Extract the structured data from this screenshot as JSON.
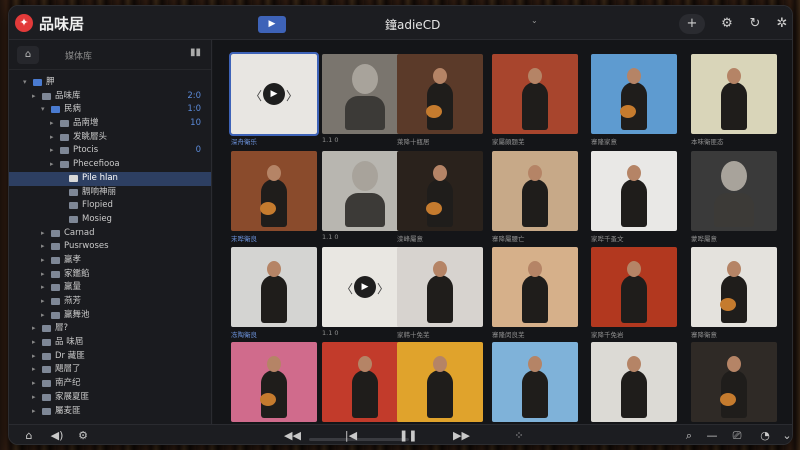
{
  "app": {
    "title": "品味居",
    "window_title": "鐘adieCD",
    "title_small": "⌄",
    "logo_glyph": "✦"
  },
  "titlebar": {
    "play_glyph": "▶",
    "icons": [
      "add-icon",
      "gear-icon",
      "refresh-icon",
      "settings-cog-icon"
    ],
    "glyphs": [
      "+",
      "⚙",
      "↻",
      "✲"
    ]
  },
  "sidebar": {
    "header_label": "媒体库",
    "button_glyph": "⌂",
    "chart_glyph": "▮▮",
    "tree": [
      {
        "label": "胛",
        "indent": 0,
        "arrow": "▾",
        "folder": "blue",
        "count": ""
      },
      {
        "label": "品味库",
        "indent": 1,
        "arrow": "▸",
        "folder": "grey",
        "count": "2:0"
      },
      {
        "label": "民病",
        "indent": 2,
        "arrow": "▾",
        "folder": "blue",
        "count": "1:0"
      },
      {
        "label": "品南增",
        "indent": 3,
        "arrow": "▸",
        "folder": "grey",
        "count": "10"
      },
      {
        "label": "发眺層头",
        "indent": 3,
        "arrow": "▸",
        "folder": "grey",
        "count": ""
      },
      {
        "label": "Ptocis",
        "indent": 3,
        "arrow": "▸",
        "folder": "grey",
        "count": "0"
      },
      {
        "label": "Phecefiooa",
        "indent": 3,
        "arrow": "▸",
        "folder": "grey",
        "count": ""
      },
      {
        "label": "Pile hlan",
        "indent": 4,
        "arrow": "",
        "folder": "white",
        "count": ""
      },
      {
        "label": "膈响神丽",
        "indent": 4,
        "arrow": "",
        "folder": "grey",
        "count": ""
      },
      {
        "label": "Flopied",
        "indent": 4,
        "arrow": "",
        "folder": "grey",
        "count": ""
      },
      {
        "label": "Mosieg",
        "indent": 4,
        "arrow": "",
        "folder": "grey",
        "count": ""
      },
      {
        "label": "Carnad",
        "indent": 2,
        "arrow": "▸",
        "folder": "grey",
        "count": ""
      },
      {
        "label": "Pusrwoses",
        "indent": 2,
        "arrow": "▸",
        "folder": "grey",
        "count": ""
      },
      {
        "label": "羸孝",
        "indent": 2,
        "arrow": "▸",
        "folder": "grey",
        "count": ""
      },
      {
        "label": "家鑑餡",
        "indent": 2,
        "arrow": "▸",
        "folder": "grey",
        "count": ""
      },
      {
        "label": "羸量",
        "indent": 2,
        "arrow": "▸",
        "folder": "grey",
        "count": ""
      },
      {
        "label": "燕芳",
        "indent": 2,
        "arrow": "▸",
        "folder": "grey",
        "count": ""
      },
      {
        "label": "羸舞池",
        "indent": 2,
        "arrow": "▸",
        "folder": "grey",
        "count": ""
      },
      {
        "label": "層?",
        "indent": 1,
        "arrow": "▸",
        "folder": "grey",
        "count": ""
      },
      {
        "label": "品 味屆",
        "indent": 1,
        "arrow": "▸",
        "folder": "grey",
        "count": ""
      },
      {
        "label": "Dr 藏匪",
        "indent": 1,
        "arrow": "▸",
        "folder": "grey",
        "count": ""
      },
      {
        "label": "飓層了",
        "indent": 1,
        "arrow": "▸",
        "folder": "grey",
        "count": ""
      },
      {
        "label": "南产纪",
        "indent": 1,
        "arrow": "▸",
        "folder": "grey",
        "count": ""
      },
      {
        "label": "家展夏匪",
        "indent": 1,
        "arrow": "▸",
        "folder": "grey",
        "count": ""
      },
      {
        "label": "屬麦匪",
        "indent": 1,
        "arrow": "▸",
        "folder": "grey",
        "count": ""
      }
    ],
    "selected_index": 7
  },
  "grid": {
    "tiles": [
      {
        "caption": "深舟衛乐",
        "bg": "#e8e6e2",
        "kind": "play",
        "active": true
      },
      {
        "caption": "1.1 0",
        "bg": "#7a756e",
        "kind": "face",
        "active": false
      },
      {
        "caption": "萊降十瓶居",
        "bg": "#5b3a29",
        "kind": "guitar",
        "active": false
      },
      {
        "caption": "家屬頗题芜",
        "bg": "#a8452d",
        "kind": "figure",
        "active": false
      },
      {
        "caption": "寨隆家意",
        "bg": "#5e9bd0",
        "kind": "guitar",
        "active": false
      },
      {
        "caption": "本味衛匪态",
        "bg": "#d9d5b9",
        "kind": "figure",
        "active": false
      },
      {
        "caption": "末哗衛良",
        "bg": "#8a4b2c",
        "kind": "guitar",
        "active": true
      },
      {
        "caption": "1.1 0",
        "bg": "#b8b6b0",
        "kind": "face",
        "active": false
      },
      {
        "caption": "滦峰屬意",
        "bg": "#2a221c",
        "kind": "guitar",
        "active": false
      },
      {
        "caption": "寨降屬腰亡",
        "bg": "#c7a988",
        "kind": "figure",
        "active": false
      },
      {
        "caption": "家哗千蚤文",
        "bg": "#e9e8e6",
        "kind": "figure",
        "active": false
      },
      {
        "caption": "蒙哗屬意",
        "bg": "#3a3a3a",
        "kind": "face",
        "active": false
      },
      {
        "caption": "冻陶衛良",
        "bg": "#d4d4d2",
        "kind": "figure",
        "active": true
      },
      {
        "caption": "1.1 0",
        "bg": "#e9e7e2",
        "kind": "play",
        "active": false
      },
      {
        "caption": "家韩十免芜",
        "bg": "#d7d3cf",
        "kind": "figure",
        "active": false
      },
      {
        "caption": "寨隆闵良芜",
        "bg": "#d6b08a",
        "kind": "figure",
        "active": false
      },
      {
        "caption": "家降千免岩",
        "bg": "#b2381f",
        "kind": "figure",
        "active": false
      },
      {
        "caption": "寨降衛意",
        "bg": "#e4e2dd",
        "kind": "guitar",
        "active": false
      },
      {
        "caption": "",
        "bg": "#d06b8c",
        "kind": "guitar",
        "active": false
      },
      {
        "caption": "",
        "bg": "#c23b2b",
        "kind": "figure",
        "active": false
      },
      {
        "caption": "",
        "bg": "#e0a32c",
        "kind": "figure",
        "active": false
      },
      {
        "caption": "",
        "bg": "#7fb2d9",
        "kind": "figure",
        "active": false
      },
      {
        "caption": "",
        "bg": "#dcdad5",
        "kind": "figure",
        "active": false
      },
      {
        "caption": "",
        "bg": "#2f2a26",
        "kind": "guitar",
        "active": false
      }
    ]
  },
  "bottombar": {
    "left_icons": [
      "home-icon",
      "volume-icon",
      "settings-icon"
    ],
    "left_glyphs": [
      "⌂",
      "◀)",
      "⚙"
    ],
    "transport": [
      "rewind-icon",
      "previous-icon",
      "pause-icon",
      "fast-forward-icon",
      "grid-icon"
    ],
    "transport_glyphs": [
      "◀◀",
      "|◀",
      "❚❚",
      "▶▶",
      "⁘"
    ],
    "right_icons": [
      "search-icon",
      "minus-icon",
      "cast-icon",
      "timer-icon",
      "chevron-down-icon"
    ],
    "right_glyphs": [
      "⌕",
      "—",
      "⎚",
      "◔",
      "⌄"
    ]
  },
  "colors": {
    "accent": "#3e63b8",
    "count_blue": "#5b8ad8",
    "logo_red": "#e23a3a"
  }
}
